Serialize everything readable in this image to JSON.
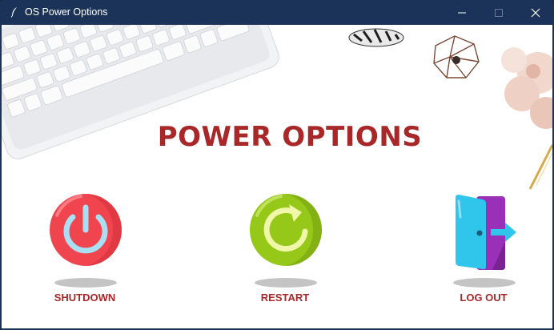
{
  "window": {
    "title": "OS Power Options",
    "controls": [
      "minimize",
      "maximize",
      "close"
    ]
  },
  "main": {
    "heading": "POWER OPTIONS",
    "options": [
      {
        "label": "SHUTDOWN",
        "icon": "power-icon",
        "color": "#f0454f"
      },
      {
        "label": "RESTART",
        "icon": "restart-icon",
        "color": "#96c81a"
      },
      {
        "label": "LOG OUT",
        "icon": "logout-door-icon",
        "color": "#30c6ec"
      }
    ]
  },
  "colors": {
    "titlebar": "#1b3358",
    "heading": "#a8282a",
    "background": "#ffffff"
  }
}
